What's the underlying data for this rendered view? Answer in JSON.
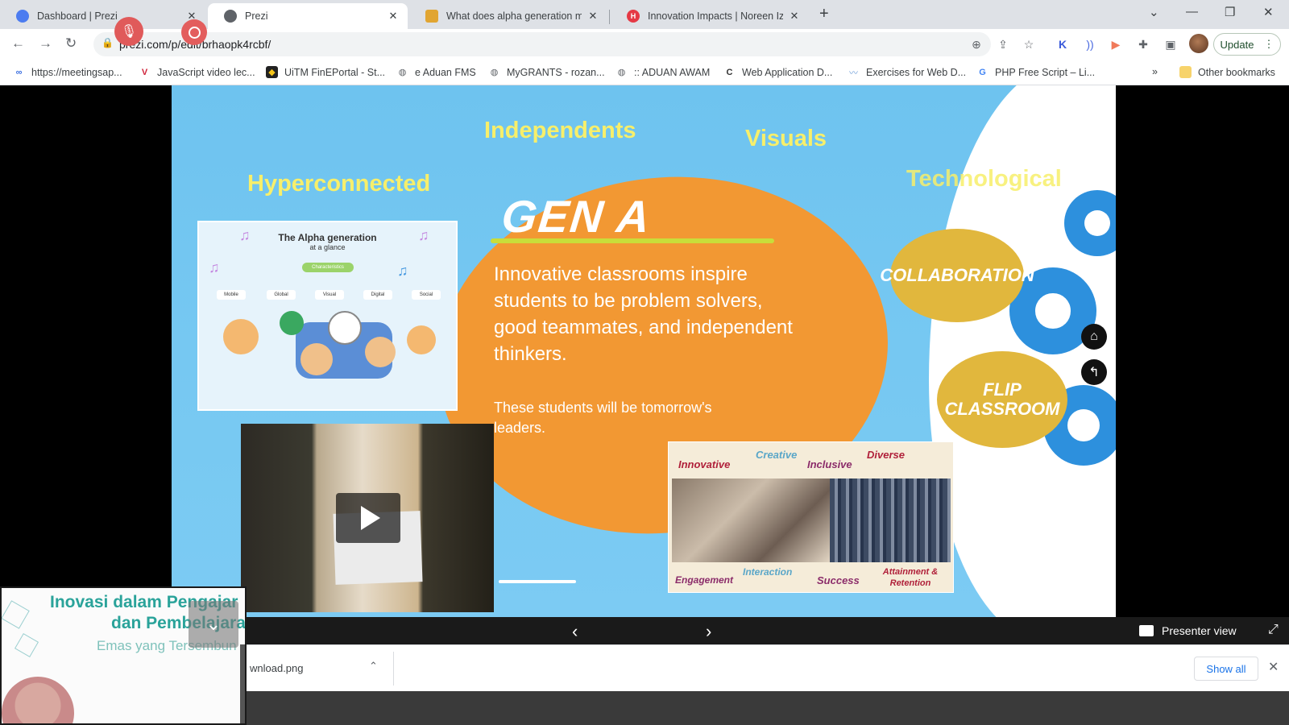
{
  "browser": {
    "tabs": [
      {
        "title": "Dashboard | Prezi",
        "active": false,
        "favicon_color": "#4c7cf0"
      },
      {
        "title": "Prezi",
        "active": true,
        "favicon_color": "#5f6368"
      },
      {
        "title": "What does alpha generation me…",
        "active": false,
        "favicon_color": "#e1a532"
      },
      {
        "title": "Innovation Impacts | Noreen Izza…",
        "active": false,
        "favicon_color": "#e53945",
        "favicon_letter": "H"
      }
    ],
    "url": "prezi.com/p/edit/brhaopk4rcbf/",
    "update_label": "Update",
    "bookmarks": [
      "https://meetingsap...",
      "JavaScript video lec...",
      "UiTM FinEPortal - St...",
      "e Aduan FMS",
      "MyGRANTS - rozan...",
      ":: ADUAN AWAM",
      "Web Application D...",
      "Exercises for Web D...",
      "PHP Free Script – Li..."
    ],
    "more_bookmarks": "»",
    "other_bookmarks": "Other bookmarks"
  },
  "slide": {
    "words": {
      "independents": "Independents",
      "visuals": "Visuals",
      "hyperconnected": "Hyperconnected",
      "technological": "Technological"
    },
    "heading": "GEN A",
    "main_text": "Innovative classrooms inspire students to be problem solvers, good teammates, and independent thinkers.",
    "sub_text": "These students will be tomorrow's leaders.",
    "info_card": {
      "title": "The Alpha generation",
      "subtitle": "at a glance",
      "main_chip": "Characteristics",
      "chips": [
        "Mobile",
        "Global",
        "Visual",
        "Digital",
        "Social"
      ]
    },
    "photo_card": {
      "top_words": [
        "Innovative",
        "Creative",
        "Inclusive",
        "Diverse"
      ],
      "bottom_words": [
        "Engagement",
        "Interaction",
        "Success",
        "Attainment & Retention"
      ]
    },
    "blobs": {
      "collaboration": "COLLABORATION",
      "flip": "FLIP CLASSROOM"
    },
    "colors": {
      "slide_bg": "#76c8f2",
      "orange": "#f29833",
      "accent_yellow": "#f7ef6b",
      "blob_gold": "#e1b73d",
      "gear_blue": "#2d90dd"
    }
  },
  "prezi_bar": {
    "prev_icon": "‹",
    "next_icon": "›",
    "presenter_label": "Presenter view"
  },
  "download_shelf": {
    "file_name": "wnload.png",
    "show_all": "Show all"
  },
  "webcam": {
    "line1": "Inovasi dalam Pengajar",
    "line2": "dan Pembelajara",
    "line3": "Emas yang Tersembun"
  }
}
